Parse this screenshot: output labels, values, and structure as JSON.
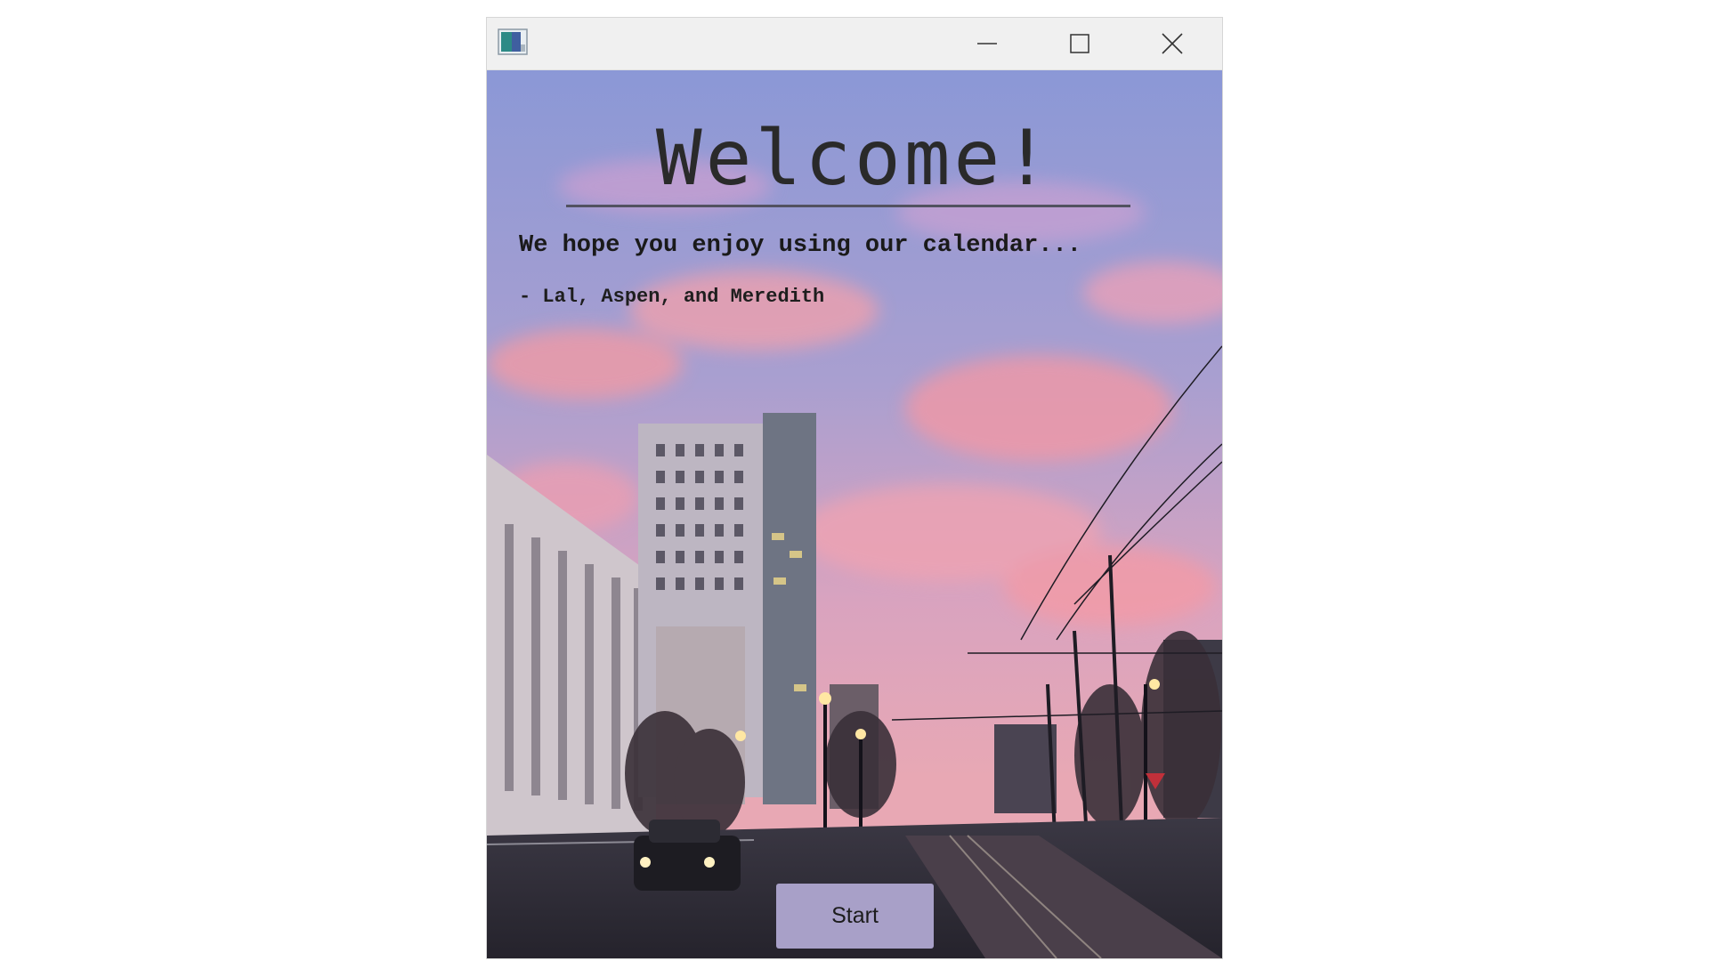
{
  "window": {
    "icon": "app-icon",
    "controls": {
      "minimize": "minimize-icon",
      "maximize": "maximize-icon",
      "close": "close-icon"
    }
  },
  "welcome": {
    "title": "Welcome!",
    "subtitle": "We hope you enjoy using our calendar...",
    "signature": "- Lal, Aspen, and Meredith"
  },
  "actions": {
    "start_label": "Start"
  },
  "colors": {
    "sky_top": "#8f9ad6",
    "sky_pink": "#f29aa3",
    "start_button": "#a8a0c8",
    "titlebar": "#f0f0f0"
  }
}
